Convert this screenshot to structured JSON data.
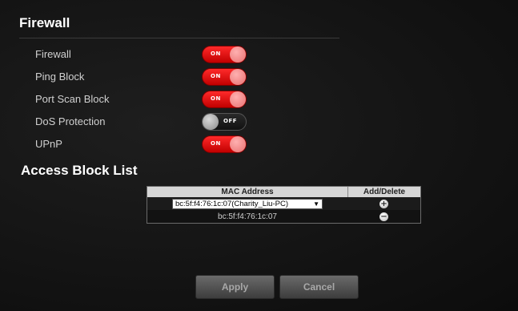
{
  "firewall": {
    "title": "Firewall",
    "rows": [
      {
        "label": "Firewall",
        "state": "ON"
      },
      {
        "label": "Ping Block",
        "state": "ON"
      },
      {
        "label": "Port Scan Block",
        "state": "ON"
      },
      {
        "label": "DoS Protection",
        "state": "OFF"
      },
      {
        "label": "UPnP",
        "state": "ON"
      }
    ]
  },
  "access_block": {
    "title": "Access Block List",
    "columns": [
      "MAC Address",
      "Add/Delete"
    ],
    "select_value": "bc:5f:f4:76:1c:07(Charity_Liu-PC)",
    "entries": [
      {
        "mac": "bc:5f:f4:76:1c:07"
      }
    ],
    "add_icon": "plus-circle-icon",
    "delete_icon": "minus-circle-icon"
  },
  "buttons": {
    "apply": "Apply",
    "cancel": "Cancel"
  },
  "colors": {
    "toggle_on": "#e00000",
    "toggle_off": "#1a1a1a",
    "background": "#141414"
  }
}
